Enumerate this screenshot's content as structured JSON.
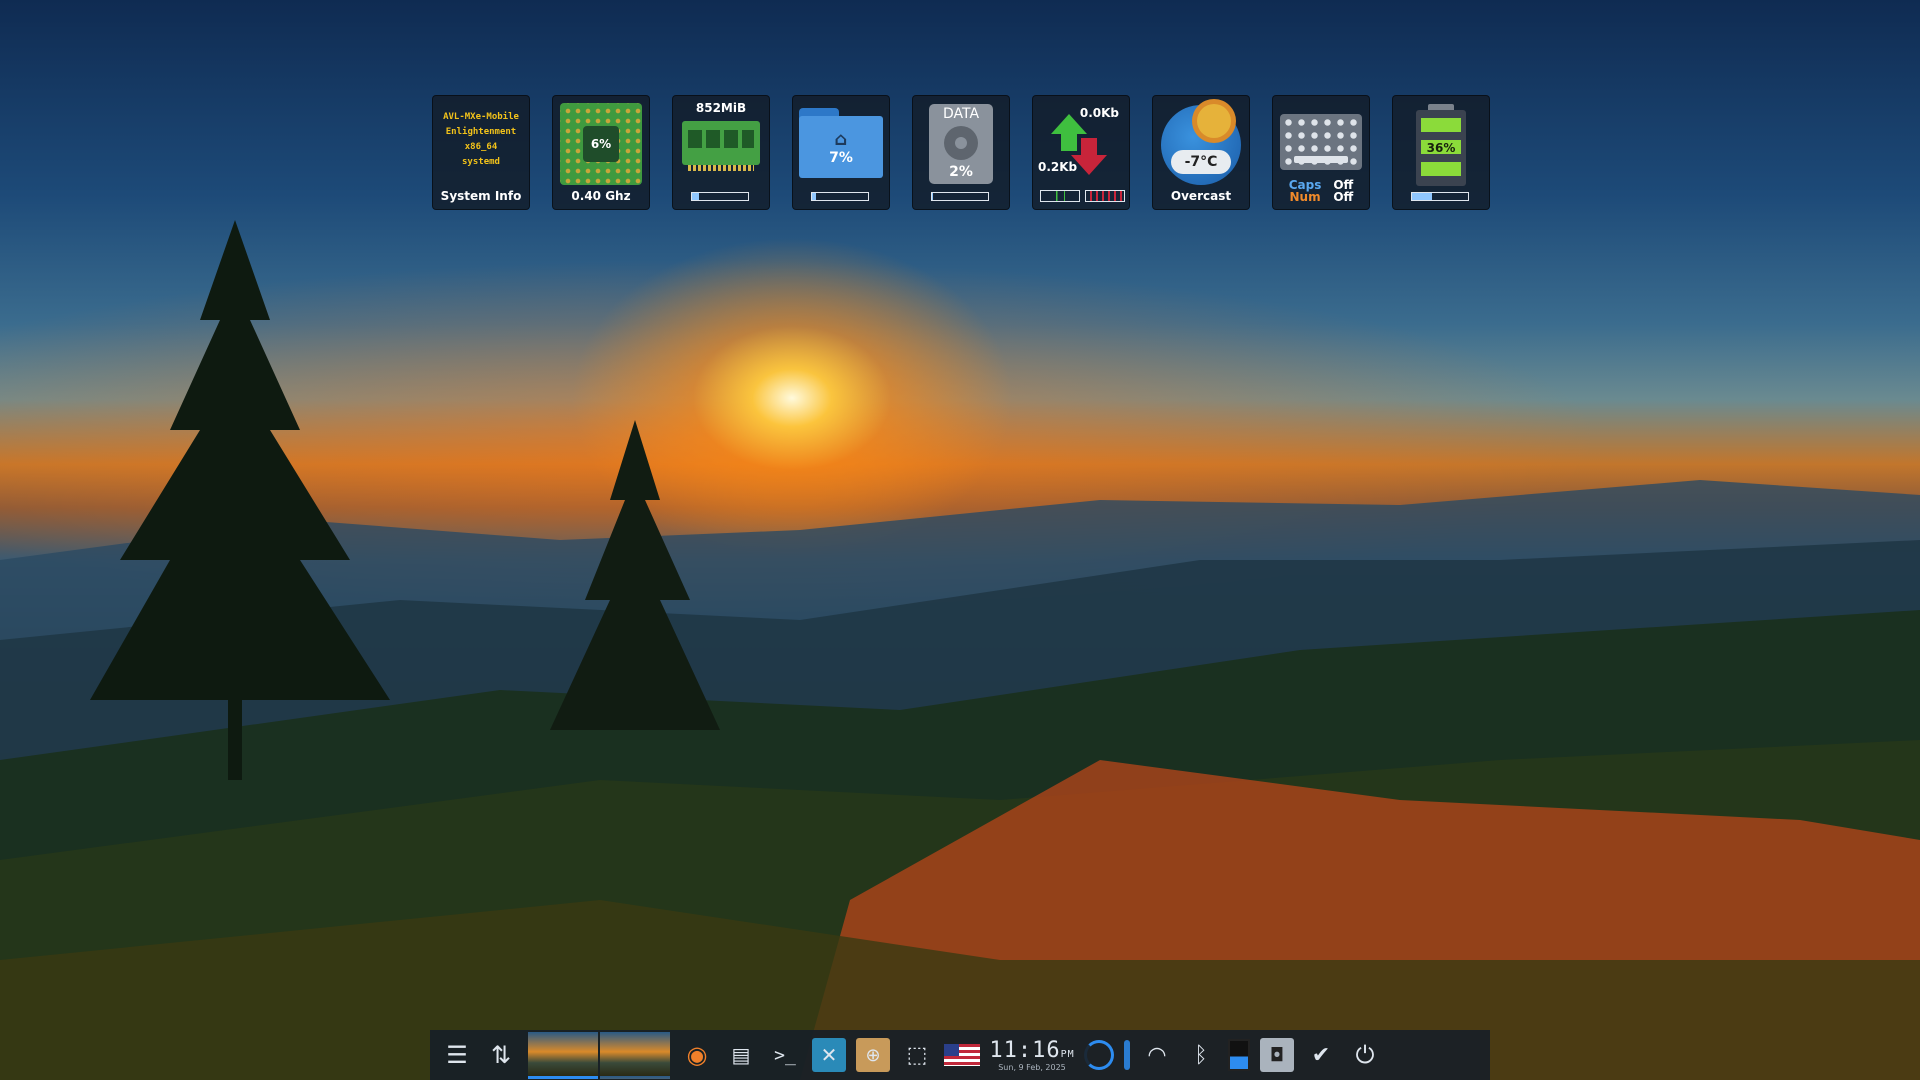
{
  "gadgets": {
    "sysinfo": {
      "lines": [
        "AVL-MXe-Mobile",
        "Enlightenment",
        "x86_64",
        "systemd"
      ],
      "label": "System Info"
    },
    "cpu": {
      "usage": "6%",
      "freq": "0.40 Ghz"
    },
    "memory": {
      "used": "852MiB",
      "fill": 0.12
    },
    "home": {
      "usage": "7%",
      "fill": 0.07
    },
    "data_disk": {
      "title": "DATA",
      "usage": "2%",
      "fill": 0.02
    },
    "network": {
      "up": "0.0Kb",
      "down": "0.2Kb"
    },
    "weather": {
      "temp": "-7°C",
      "condition": "Overcast"
    },
    "keyboard": {
      "caps_label": "Caps",
      "num_label": "Num",
      "caps_state": "Off",
      "num_state": "Off"
    },
    "battery": {
      "level": "36%",
      "fill": 0.36
    }
  },
  "shelf": {
    "clock_time": "11:16",
    "clock_ampm": "PM",
    "clock_date": "Sun, 9 Feb, 2025",
    "icons": [
      "menu-icon",
      "settings-icon",
      "firefox-icon",
      "file-manager-icon",
      "terminal-icon",
      "tools-icon",
      "package-installer-icon",
      "screenshot-icon",
      "us-flag-icon",
      "volume-icon",
      "thermometer-icon",
      "wifi-icon",
      "bluetooth-icon",
      "battery-icon",
      "disk-icon",
      "updates-icon",
      "power-icon"
    ],
    "colors": {
      "accent": "#2d8cf0",
      "shelf_bg": "#161e28"
    }
  }
}
